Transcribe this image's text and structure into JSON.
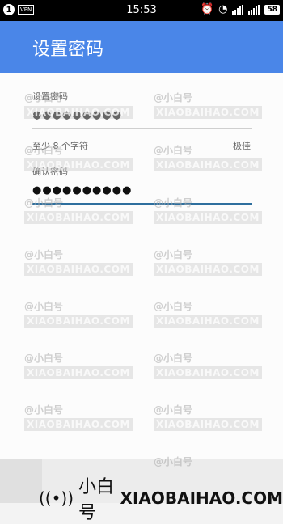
{
  "status_bar": {
    "badge": "1",
    "vpn": "VPN",
    "time": "15:53",
    "battery": "58",
    "icons": [
      "alarm-icon",
      "wifi-icon",
      "signal-icon",
      "battery-icon"
    ]
  },
  "app_bar": {
    "title": "设置密码"
  },
  "form": {
    "password_label": "设置密码",
    "password_value": "●●●●●●●●●",
    "hint_text": "至少 8 个字符",
    "strength_text": "极佳",
    "confirm_label": "确认密码",
    "confirm_value": "●●●●●●●●●●"
  },
  "watermark": {
    "cn": "@小白号",
    "en": "XIAOBAIHAO.COM",
    "bottom_cn": "小白号",
    "bottom_en": "XIAOBAIHAO.COM"
  },
  "colors": {
    "app_bar": "#4a86e8",
    "active_line": "#2e6f9e"
  }
}
